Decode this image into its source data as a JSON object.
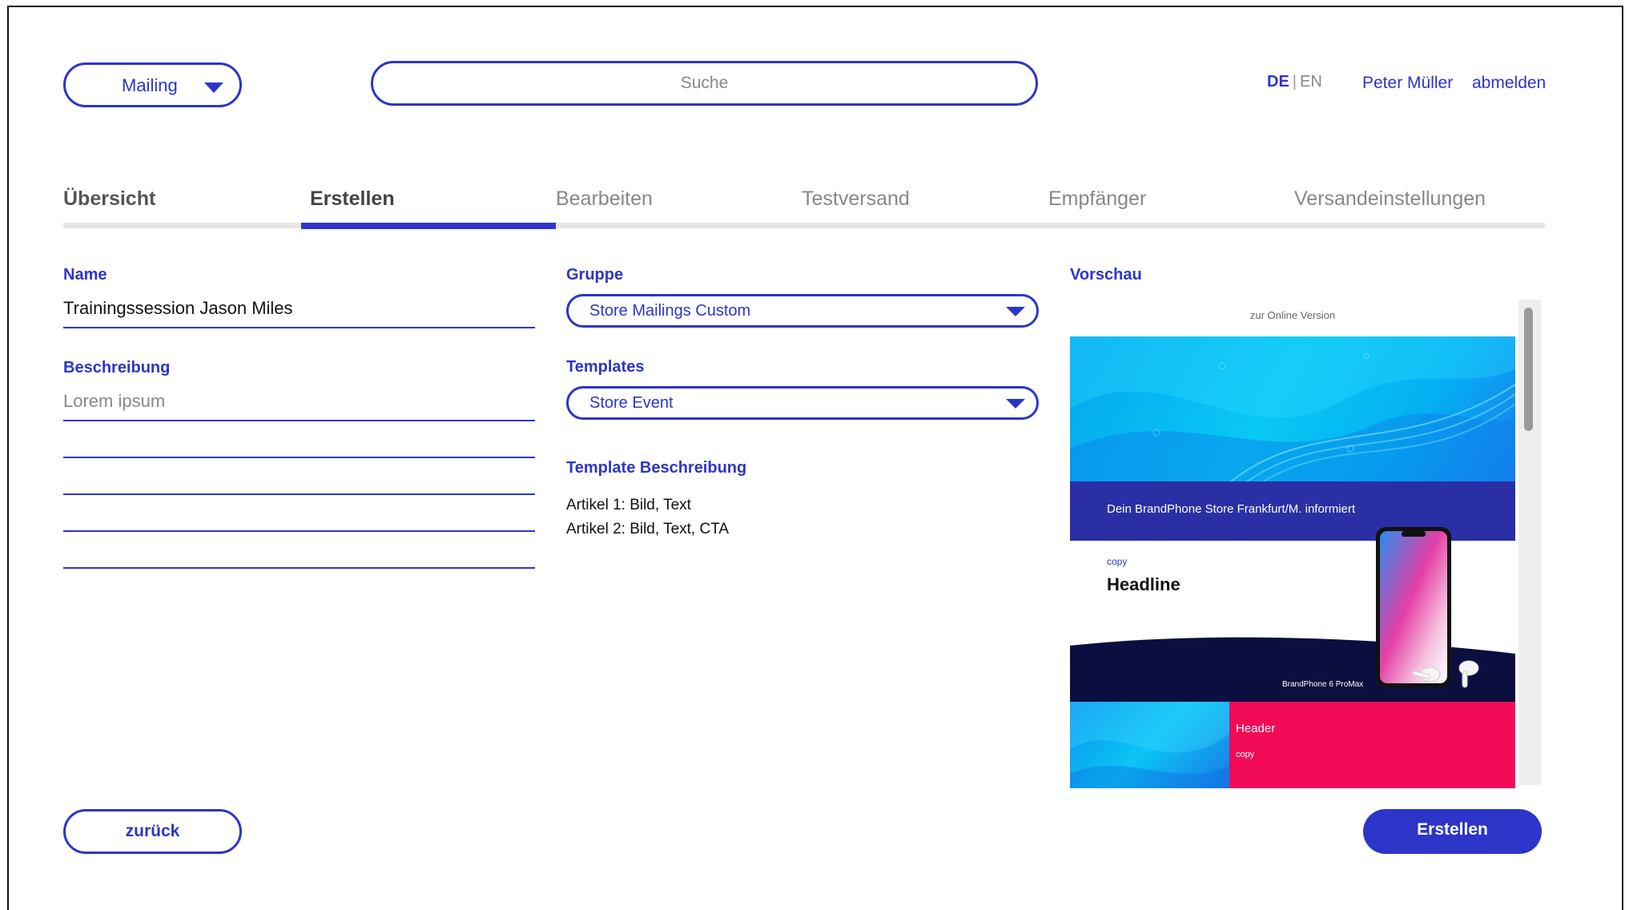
{
  "header": {
    "mailing_select": "Mailing",
    "search_placeholder": "Suche",
    "lang_de": "DE",
    "lang_sep": "|",
    "lang_en": "EN",
    "user_name": "Peter Müller",
    "logout": "abmelden"
  },
  "tabs": [
    {
      "label": "Übersicht",
      "state": "done"
    },
    {
      "label": "Erstellen",
      "state": "active"
    },
    {
      "label": "Bearbeiten",
      "state": "inactive"
    },
    {
      "label": "Testversand",
      "state": "inactive"
    },
    {
      "label": "Empfänger",
      "state": "inactive"
    },
    {
      "label": "Versandeinstellungen",
      "state": "inactive"
    }
  ],
  "form": {
    "name_label": "Name",
    "name_value": "Trainingssession Jason Miles",
    "description_label": "Beschreibung",
    "description_placeholder": "Lorem ipsum",
    "group_label": "Gruppe",
    "group_value": "Store Mailings Custom",
    "templates_label": "Templates",
    "templates_value": "Store Event",
    "template_desc_label": "Template Beschreibung",
    "template_desc_lines": [
      "Artikel 1: Bild, Text",
      "Artikel 2: Bild, Text, CTA"
    ]
  },
  "preview": {
    "label": "Vorschau",
    "online_version": "zur Online Version",
    "bar_text": "Dein BrandPhone Store Frankfurt/M. informiert",
    "copy_small": "copy",
    "headline": "Headline",
    "product_name": "BrandPhone 6 ProMax",
    "tile_header": "Header",
    "tile_copy": "copy"
  },
  "buttons": {
    "back": "zurück",
    "create": "Erstellen"
  },
  "colors": {
    "accent": "#2d35c9",
    "pink": "#f10a55",
    "navy": "#0b0f3f"
  }
}
